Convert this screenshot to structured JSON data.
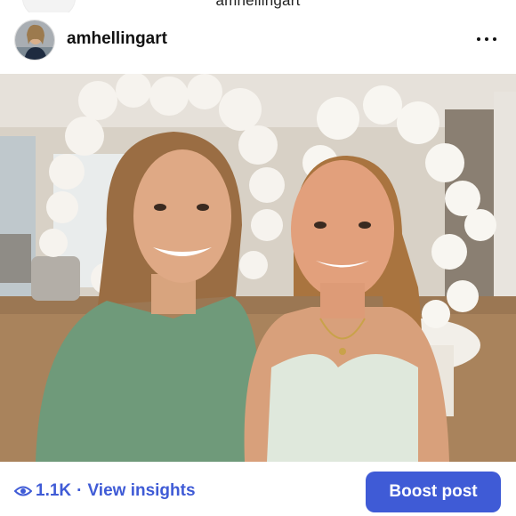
{
  "nav": {
    "title": "amhellingart"
  },
  "post": {
    "username": "amhellingart",
    "avatar_icon": "profile-photo",
    "more_icon": "more-horizontal-icon"
  },
  "photo": {
    "description_icon": "photo-image"
  },
  "footer": {
    "views_icon": "eye-icon",
    "views_count": "1.1K",
    "separator": "·",
    "insights_label": "View insights",
    "boost_label": "Boost post"
  },
  "colors": {
    "accent": "#3f5bd6",
    "text": "#111111"
  }
}
